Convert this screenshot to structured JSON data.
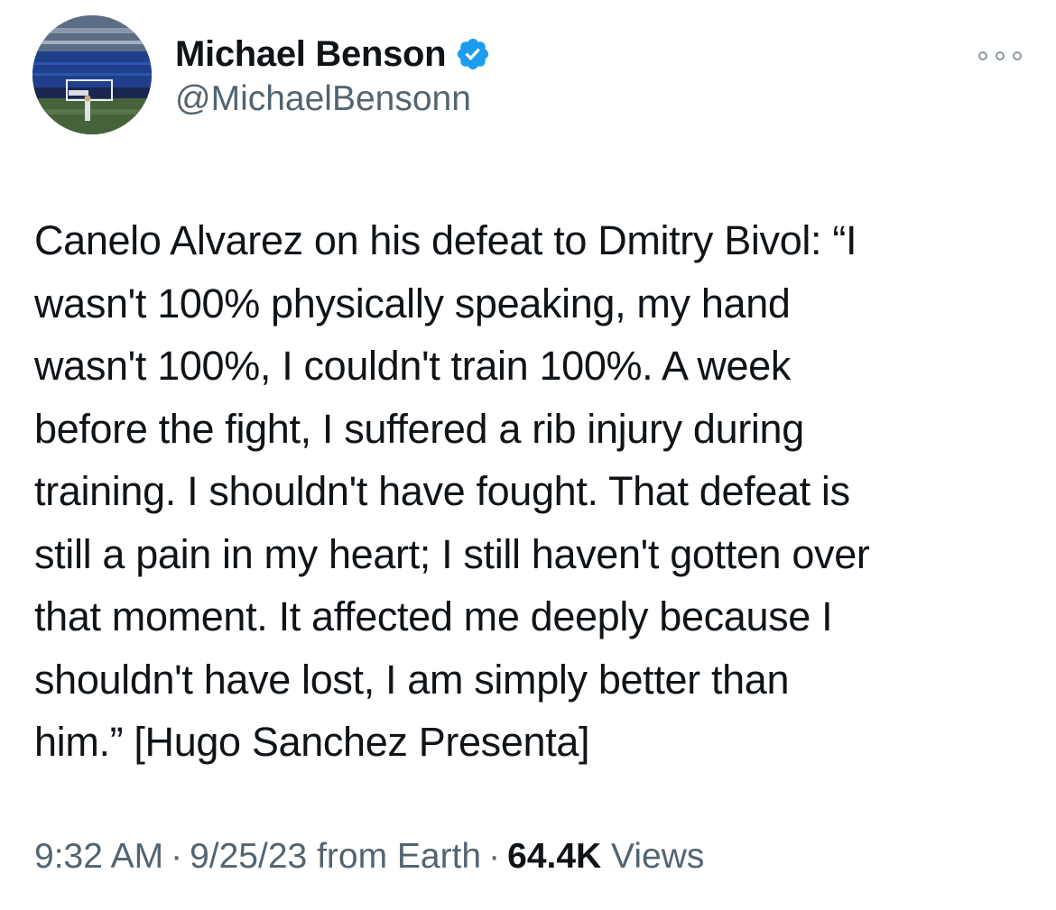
{
  "author": {
    "display_name": "Michael Benson",
    "handle": "@MichaelBensonn",
    "verified_icon": "verified-badge-icon",
    "avatar_icon": "stadium-photo-avatar"
  },
  "more_icon": "more-options-icon",
  "tweet": {
    "text": "Canelo Alvarez on his defeat to Dmitry Bivol: “I\nwasn't 100% physically speaking, my hand\nwasn't 100%, I couldn't train 100%. A week\nbefore the fight, I suffered a rib injury during\ntraining. I shouldn't have fought. That defeat is\nstill a pain in my heart; I still haven't gotten over\nthat moment. It affected me deeply because I\nshouldn't have lost, I am simply better than\nhim.” [Hugo Sanchez Presenta]"
  },
  "meta": {
    "time": "9:32 AM",
    "separator": "·",
    "date": "9/25/23",
    "source": "from Earth",
    "views_count": "64.4K",
    "views_label": "Views"
  },
  "colors": {
    "text": "#0f1419",
    "secondary": "#536471",
    "verified": "#1d9bf0"
  }
}
